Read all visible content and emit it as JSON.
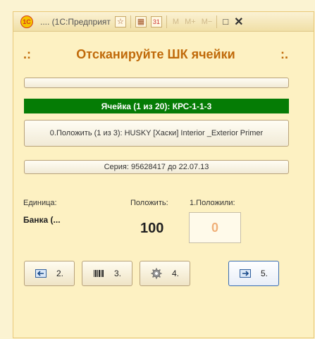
{
  "window": {
    "title": ".... (1С:Предприят",
    "title_icons": {
      "favorite": "☆",
      "calculator": "▦",
      "calendar": "31"
    },
    "memory_buttons": [
      "M",
      "M+",
      "M−"
    ],
    "maximize": "□",
    "close": "✕"
  },
  "header": {
    "left": ".:",
    "title": "Отсканируйте ШК ячейки",
    "right": ":."
  },
  "progress": {
    "fraction": 0.0
  },
  "cell_bar": {
    "text": "Ячейка (1 из 20): КРС-1-1-3",
    "color": "#057c05"
  },
  "put_line": "0.Положить (1 из 3): HUSKY [Хаски] Interior _Exterior Primer",
  "series": "Серия: 95628417 до 22.07.13",
  "labels": {
    "unit": "Единица:",
    "put": "Положить:",
    "placed": "1.Положили:"
  },
  "values": {
    "unit": "Банка (...",
    "put": "100",
    "placed": "0"
  },
  "buttons": [
    {
      "label": "2.",
      "icon": "arrow-left-icon"
    },
    {
      "label": "3.",
      "icon": "barcode-icon"
    },
    {
      "label": "4.",
      "icon": "gear-icon"
    },
    {
      "label": "5.",
      "icon": "arrow-right-icon"
    }
  ]
}
